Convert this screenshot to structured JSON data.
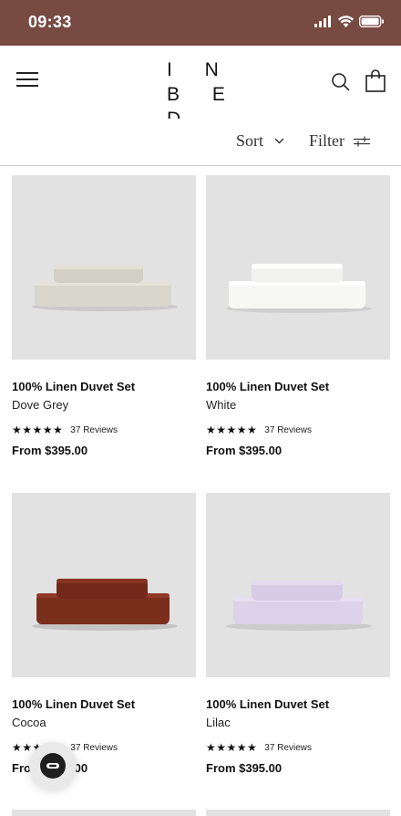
{
  "status_bar": {
    "time": "09:33",
    "signal_icon": "signal-icon",
    "wifi_icon": "wifi-icon",
    "battery_icon": "battery-icon",
    "bg_color": "#774b42"
  },
  "header": {
    "logo_line1": "I N",
    "logo_line2": "B E D",
    "menu_icon": "hamburger-menu-icon",
    "search_icon": "search-icon",
    "bag_icon": "shopping-bag-icon"
  },
  "toolbar": {
    "sort_label": "Sort",
    "filter_label": "Filter"
  },
  "products": [
    {
      "title": "100% Linen Duvet Set",
      "color": "Dove Grey",
      "stars": "★★★★★",
      "reviews": "37 Reviews",
      "price": "From $395.00",
      "swatch": "#d9d6cc"
    },
    {
      "title": "100% Linen Duvet Set",
      "color": "White",
      "stars": "★★★★★",
      "reviews": "37 Reviews",
      "price": "From $395.00",
      "swatch": "#f7f7f5"
    },
    {
      "title": "100% Linen Duvet Set",
      "color": "Cocoa",
      "stars": "★★★★★",
      "reviews": "37 Reviews",
      "price": "From $395.00",
      "swatch": "#7a2e1c"
    },
    {
      "title": "100% Linen Duvet Set",
      "color": "Lilac",
      "stars": "★★★★★",
      "reviews": "37 Reviews",
      "price": "From $395.00",
      "swatch": "#dcd2ea"
    }
  ],
  "chat_widget": {
    "icon": "chat-bubble-icon"
  }
}
